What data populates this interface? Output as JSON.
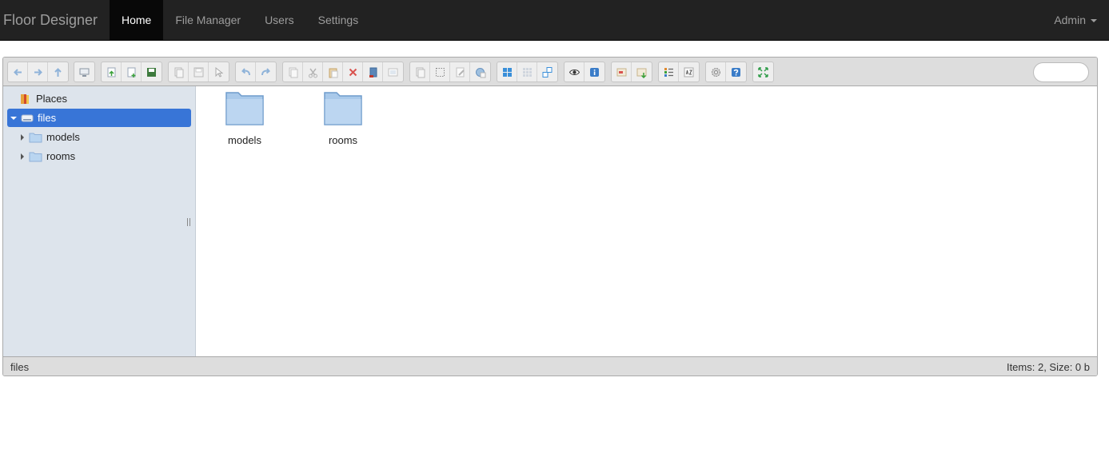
{
  "app": {
    "brand": "Floor Designer",
    "nav": [
      {
        "label": "Home",
        "active": true
      },
      {
        "label": "File Manager",
        "active": false
      },
      {
        "label": "Users",
        "active": false
      },
      {
        "label": "Settings",
        "active": false
      }
    ],
    "user": "Admin"
  },
  "toolbar": {
    "groups": [
      [
        "back-icon",
        "forward-icon",
        "up-icon"
      ],
      [
        "computer-icon"
      ],
      [
        "upload-icon",
        "new-file-icon",
        "save-icon"
      ],
      [
        "copy-doc-icon",
        "disk-icon",
        "select-icon"
      ],
      [
        "undo-icon",
        "redo-icon"
      ],
      [
        "copy-icon",
        "cut-icon",
        "paste-icon",
        "delete-icon",
        "empty-icon",
        "duplicate-icon"
      ],
      [
        "rename-icon",
        "select-all-icon",
        "edit-icon",
        "resize-icon"
      ],
      [
        "icons-view-icon",
        "grid-view-icon",
        "list-view-icon"
      ],
      [
        "preview-icon",
        "info-icon"
      ],
      [
        "extract-icon",
        "archive-icon"
      ],
      [
        "details-icon",
        "sort-icon"
      ],
      [
        "settings-icon",
        "help-icon"
      ],
      [
        "fullscreen-icon"
      ]
    ],
    "search_placeholder": ""
  },
  "tree": {
    "places": "Places",
    "root": "files",
    "children": [
      "models",
      "rooms"
    ]
  },
  "files": [
    {
      "name": "models",
      "icon": "folder-icon"
    },
    {
      "name": "rooms",
      "icon": "folder-icon"
    }
  ],
  "status": {
    "path": "files",
    "summary": "Items: 2, Size: 0 b"
  },
  "colors": {
    "navbar": "#222222",
    "selection": "#3875d7",
    "folder": "#a9c9ea",
    "tree_bg": "#dde4ec"
  }
}
